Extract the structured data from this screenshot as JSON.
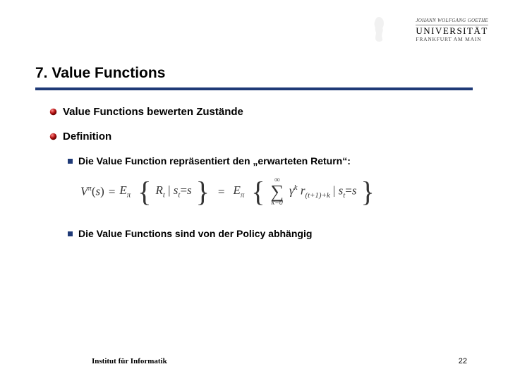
{
  "logo": {
    "line1": "JOHANN WOLFGANG GOETHE",
    "line2": "UNIVERSITÄT",
    "line3": "FRANKFURT AM MAIN"
  },
  "title": "7. Value Functions",
  "bullets": {
    "b1a": "Value Functions bewerten Zustände",
    "b1b": "Definition",
    "b2a": "Die Value Function repräsentiert den „erwarteten Return“:",
    "b2b": "Die Value Functions sind von der Policy abhängig"
  },
  "formula": {
    "V": "V",
    "pi": "π",
    "s": "s",
    "eq": "=",
    "E": "E",
    "R": "R",
    "t": "t",
    "bar": "|",
    "st": "s",
    "tsub": "t",
    "inf": "∞",
    "k0": "k=0",
    "gamma": "γ",
    "k": "k",
    "r": "r",
    "rsub": "(t+1)+k"
  },
  "footer": {
    "institute": "Institut für Informatik",
    "page": "22"
  }
}
